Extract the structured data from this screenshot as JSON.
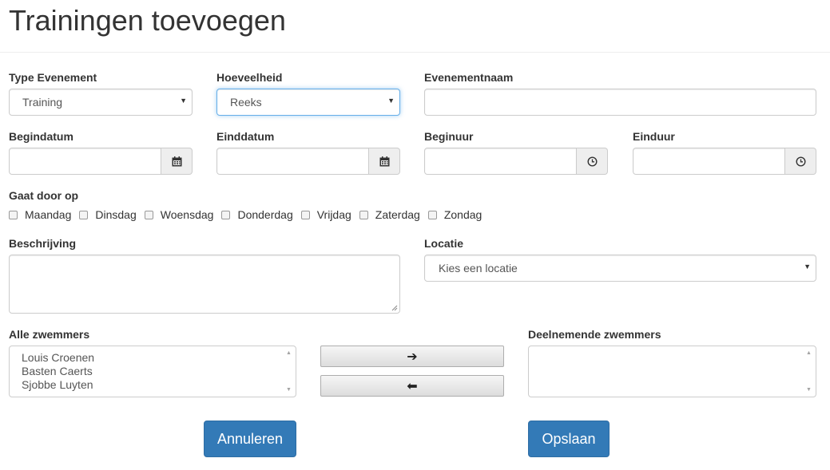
{
  "page": {
    "title": "Trainingen toevoegen"
  },
  "form": {
    "type_label": "Type Evenement",
    "type_value": "Training",
    "amount_label": "Hoeveelheid",
    "amount_value": "Reeks",
    "name_label": "Evenementnaam",
    "name_value": "",
    "start_date_label": "Begindatum",
    "end_date_label": "Einddatum",
    "start_time_label": "Beginuur",
    "end_time_label": "Einduur",
    "days_label": "Gaat door op",
    "days": [
      "Maandag",
      "Dinsdag",
      "Woensdag",
      "Donderdag",
      "Vrijdag",
      "Zaterdag",
      "Zondag"
    ],
    "description_label": "Beschrijving",
    "location_label": "Locatie",
    "location_value": "Kies een locatie"
  },
  "swimmers": {
    "all_label": "Alle zwemmers",
    "all": [
      "Louis Croenen",
      "Basten Caerts",
      "Sjobbe Luyten"
    ],
    "participating_label": "Deelnemende zwemmers",
    "participating": [],
    "move_right": "➔",
    "move_left": "⬅"
  },
  "buttons": {
    "cancel": "Annuleren",
    "save": "Opslaan"
  },
  "colors": {
    "primary": "#337ab7",
    "focus": "#66afe9"
  },
  "icons": {
    "date": "calendar-icon",
    "time": "clock-icon"
  }
}
